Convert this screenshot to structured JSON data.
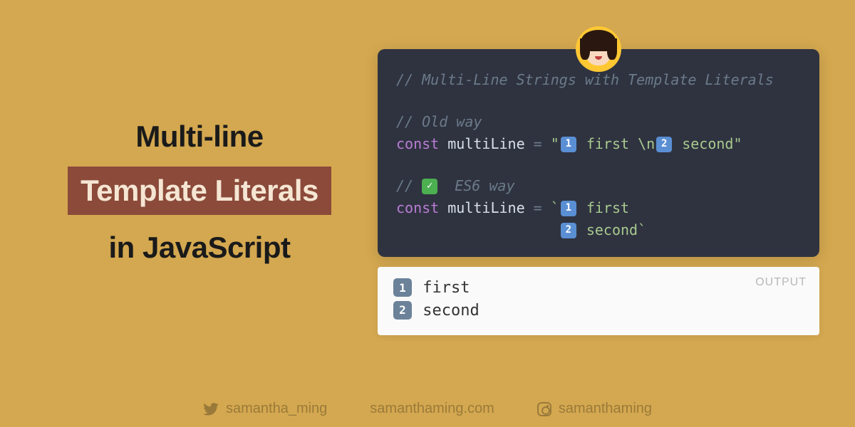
{
  "title": {
    "line1": "Multi-line",
    "line2": "Template Literals",
    "line3": "in JavaScript"
  },
  "code": {
    "comment1": "// Multi-Line Strings with Template Literals",
    "comment2": "// Old way",
    "old_kw": "const",
    "old_var": " multiLine ",
    "old_op": "= ",
    "old_str_open": "\"",
    "old_num1": "1",
    "old_str_mid1": " first \\n",
    "old_num2": "2",
    "old_str_mid2": " second",
    "old_str_close": "\"",
    "comment3_pre": "// ",
    "comment3_post": "  ES6 way",
    "new_kw": "const",
    "new_var": " multiLine ",
    "new_op": "= ",
    "new_str_open": "`",
    "new_num1": "1",
    "new_str_l1": " first",
    "new_pad": "                   ",
    "new_num2": "2",
    "new_str_l2": " second",
    "new_str_close": "`"
  },
  "output": {
    "label": "OUTPUT",
    "n1": "1",
    "l1": " first",
    "n2": "2",
    "l2": " second"
  },
  "footer": {
    "twitter": "samantha_ming",
    "web": "samanthaming.com",
    "instagram": "samanthaming"
  }
}
